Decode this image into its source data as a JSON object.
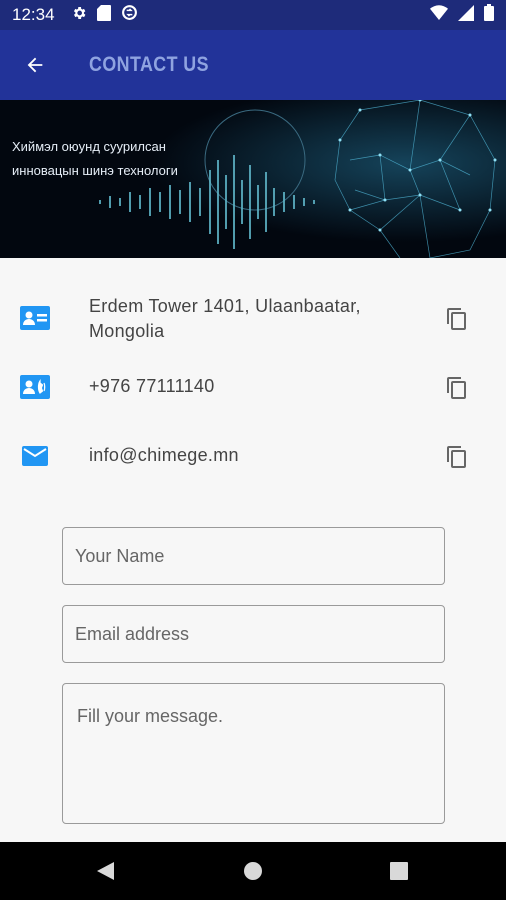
{
  "status_bar": {
    "time": "12:34"
  },
  "app_bar": {
    "title": "CONTACT US"
  },
  "banner": {
    "line1": "Хиймэл оюунд суурилсан",
    "line2": "инновацын шинэ технологи"
  },
  "contacts": [
    {
      "icon": "contact-card-icon",
      "text": "Erdem Tower 1401, Ulaanbaatar, Mongolia"
    },
    {
      "icon": "contact-phone-icon",
      "text": "+976 77111140"
    },
    {
      "icon": "email-icon",
      "text": "info@chimege.mn"
    }
  ],
  "form": {
    "name_placeholder": "Your Name",
    "email_placeholder": "Email address",
    "message_placeholder": "Fill your message."
  },
  "colors": {
    "status_bar": "#1e2b7a",
    "app_bar": "#223399",
    "title": "#8fa3e0",
    "icon_blue": "#2196f3"
  }
}
